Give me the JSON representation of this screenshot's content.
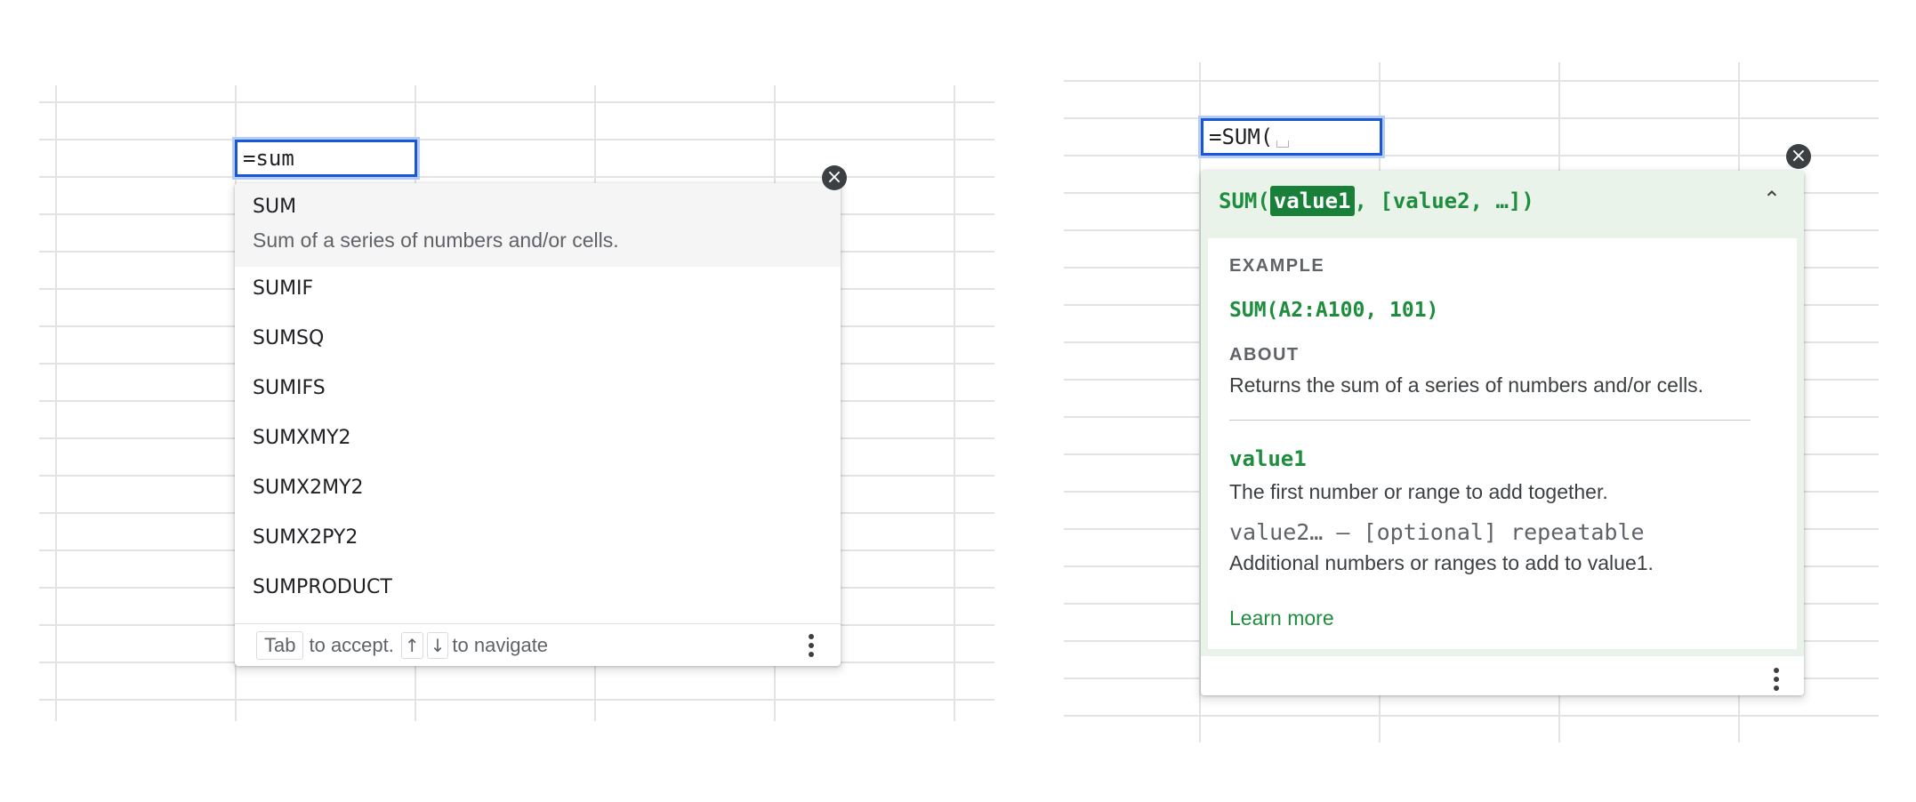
{
  "left": {
    "editor_value": "=sum",
    "suggestions": [
      {
        "name": "SUM",
        "description": "Sum of a series of numbers and/or cells."
      },
      {
        "name": "SUMIF"
      },
      {
        "name": "SUMSQ"
      },
      {
        "name": "SUMIFS"
      },
      {
        "name": "SUMXMY2"
      },
      {
        "name": "SUMX2MY2"
      },
      {
        "name": "SUMX2PY2"
      },
      {
        "name": "SUMPRODUCT"
      }
    ],
    "footer": {
      "tab_key": "Tab",
      "accept_text": "to accept.",
      "up_key": "↑",
      "down_key": "↓",
      "navigate_text": "to navigate"
    },
    "close_icon": "close-icon",
    "more_icon": "more-vert-icon"
  },
  "right": {
    "editor_value": "=SUM(",
    "signature": {
      "prefix": "SUM(",
      "active_arg": "value1",
      "suffix": ", [value2, …])"
    },
    "example_heading": "EXAMPLE",
    "example": "SUM(A2:A100, 101)",
    "about_heading": "ABOUT",
    "about_text": "Returns the sum of a series of numbers and/or cells.",
    "param1_name": "value1",
    "param1_desc": "The first number or range to add together.",
    "param2_name": "value2… – [optional] repeatable",
    "param2_desc": "Additional numbers or ranges to add to value1.",
    "learn_more": "Learn more",
    "collapse_icon": "chevron-up-icon",
    "close_icon": "close-icon",
    "more_icon": "more-vert-icon"
  },
  "colors": {
    "accent_blue": "#1a57d6",
    "help_green": "#1e8e3e",
    "help_bg": "#e9f3ea",
    "gridline": "#e2e3e3"
  }
}
